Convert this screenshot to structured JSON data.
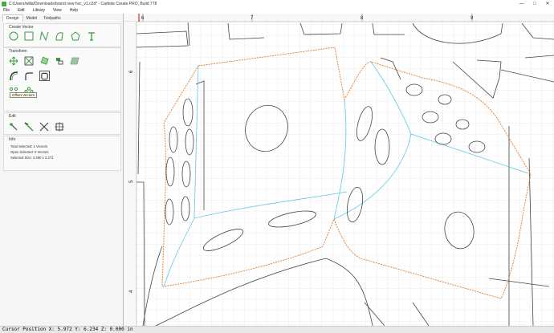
{
  "window": {
    "title": "C:/Users/willa/Downloads/brand new hvc_v1.c2d* - Carbide Create PRO, Build 778",
    "minimize": "—",
    "maximize": "□",
    "close": "✕"
  },
  "menu": [
    "File",
    "Edit",
    "Library",
    "View",
    "Help"
  ],
  "tabs": [
    "Design",
    "Model",
    "Toolpaths"
  ],
  "sections": {
    "create_vector": "Create Vector",
    "transform": "Transform",
    "edit": "Edit",
    "info": "Info"
  },
  "tooltip": "Offset Vectors",
  "info": {
    "total_selected": "Total Selected:  1 Vectors",
    "open_selected": "Open Selected:  0 Vectors",
    "selected_size": "Selected Size:    3.390 x 2.272"
  },
  "rulers": {
    "top": [
      "6",
      "7",
      "8",
      "9"
    ],
    "left": [
      "6",
      "5",
      "4"
    ]
  },
  "status": {
    "cursor": "Cursor Position X: 5.972 Y: 6.234 Z: 0.000 in"
  },
  "colors": {
    "accent_green": "#3a9a3a",
    "selection_orange": "#e87722",
    "construction_cyan": "#5bc8e8",
    "grid": "#d8d8d8",
    "origin_red": "#cc0000"
  }
}
